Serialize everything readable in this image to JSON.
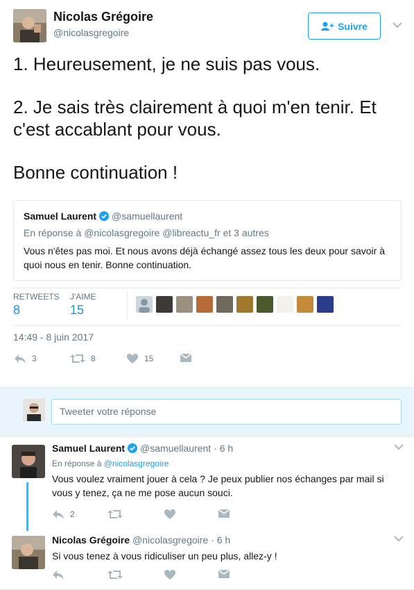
{
  "main_tweet": {
    "author_name": "Nicolas Grégoire",
    "author_handle": "@nicolasgregoire",
    "follow_label": "Suivre",
    "paragraphs": [
      "1. Heureusement, je ne suis pas vous.",
      "2. Je sais très clairement à quoi m'en tenir. Et c'est accablant pour vous.",
      "Bonne continuation !"
    ],
    "quoted": {
      "author_name": "Samuel Laurent",
      "author_handle": "@samuellaurent",
      "reply_prefix": "En réponse à",
      "reply_to": "@nicolasgregoire @libreactu_fr et 3 autres",
      "text": "Vous n'êtes pas moi. Et nous avons déjà échangé assez tous les deux pour savoir à quoi nous en tenir. Bonne continuation."
    },
    "stats": {
      "retweets_label": "RETWEETS",
      "retweets_value": "8",
      "likes_label": "J'AIME",
      "likes_value": "15"
    },
    "timestamp": "14:49 - 8 juin 2017",
    "actions": {
      "reply_count": "3",
      "retweet_count": "8",
      "like_count": "15"
    }
  },
  "reply_box": {
    "placeholder": "Tweeter votre réponse"
  },
  "replies": [
    {
      "author_name": "Samuel Laurent",
      "author_handle": "@samuellaurent",
      "time": "· 6 h",
      "reply_prefix": "En réponse à",
      "reply_to": "@nicolasgregoire",
      "text": "Vous voulez vraiment jouer à cela ? Je peux publier nos échanges par mail si vous y tenez, ça ne me pose aucun souci.",
      "reply_count": "2"
    },
    {
      "author_name": "Nicolas Grégoire",
      "author_handle": "@nicolasgregoire",
      "time": "· 6 h",
      "text": "Si vous tenez à vous ridiculiser un peu plus, allez-y !"
    }
  ],
  "colors": {
    "accent": "#1da1f2",
    "muted": "#657786",
    "reply_bg": "#e8f5fd"
  }
}
